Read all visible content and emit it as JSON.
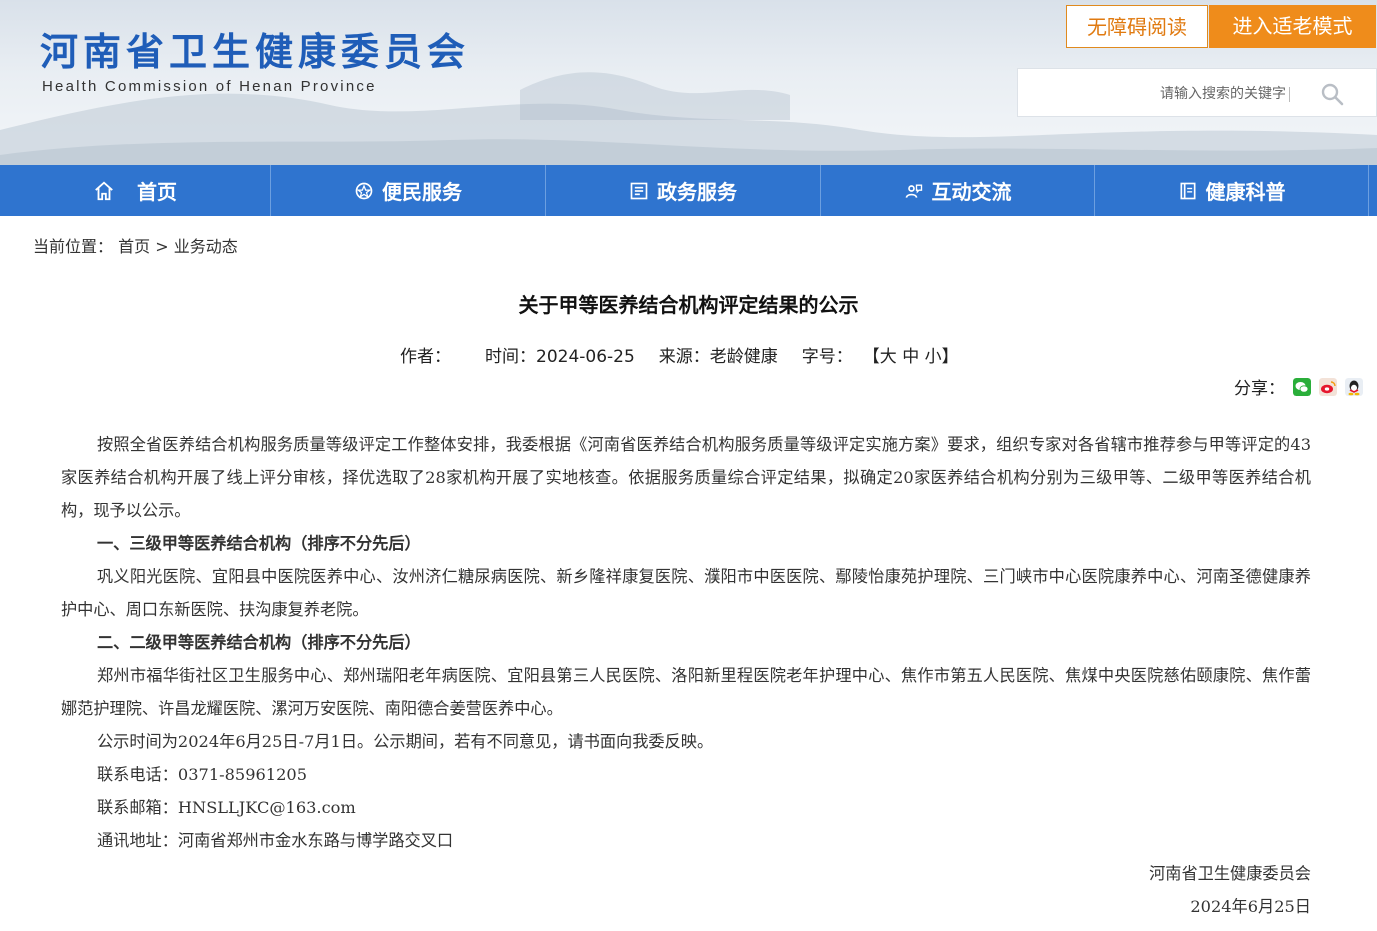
{
  "header": {
    "logo_cn": "河南省卫生健康委员会",
    "logo_en": "Health Commission of Henan Province",
    "accessibility_label": "无障碍阅读",
    "elder_mode_label": "进入适老模式",
    "search_placeholder": "请输入搜索的关键字",
    "brand_color": "#1f5db8",
    "accent_color": "#ef8c1b"
  },
  "nav": {
    "color": "#2f74cf",
    "items": [
      {
        "label": "首页",
        "icon": "home-icon"
      },
      {
        "label": "便民服务",
        "icon": "service-icon"
      },
      {
        "label": "政务服务",
        "icon": "government-icon"
      },
      {
        "label": "互动交流",
        "icon": "interaction-icon"
      },
      {
        "label": "健康科普",
        "icon": "health-book-icon"
      }
    ]
  },
  "breadcrumb": {
    "prefix": "当前位置：",
    "home": "首页",
    "separator": ">",
    "current": "业务动态"
  },
  "article": {
    "title": "关于甲等医养结合机构评定结果的公示",
    "author_label": "作者：",
    "time_label": "时间：",
    "time": "2024-06-25",
    "source_label": "来源：",
    "source": "老龄健康",
    "fontsize_label": "字号：",
    "fontsize_open": "【",
    "fontsize_large": "大",
    "fontsize_medium": "中",
    "fontsize_small": "小",
    "fontsize_close": "】",
    "share_label": "分享：",
    "share_icons": [
      "wechat-icon",
      "weibo-icon",
      "qq-icon"
    ],
    "paragraphs": [
      {
        "text": "按照全省医养结合机构服务质量等级评定工作整体安排，我委根据《河南省医养结合机构服务质量等级评定实施方案》要求，组织专家对各省辖市推荐参与甲等评定的43家医养结合机构开展了线上评分审核，择优选取了28家机构开展了实地核查。依据服务质量综合评定结果，拟确定20家医养结合机构分别为三级甲等、二级甲等医养结合机构，现予以公示。",
        "style": "normal"
      },
      {
        "text": "一、三级甲等医养结合机构（排序不分先后）",
        "style": "h"
      },
      {
        "text": "巩义阳光医院、宜阳县中医院医养中心、汝州济仁糖尿病医院、新乡隆祥康复医院、濮阳市中医医院、鄢陵怡康苑护理院、三门峡市中心医院康养中心、河南圣德健康养护中心、周口东新医院、扶沟康复养老院。",
        "style": "normal"
      },
      {
        "text": "二、二级甲等医养结合机构（排序不分先后）",
        "style": "h"
      },
      {
        "text": "郑州市福华街社区卫生服务中心、郑州瑞阳老年病医院、宜阳县第三人民医院、洛阳新里程医院老年护理中心、焦作市第五人民医院、焦煤中央医院慈佑颐康院、焦作蕾娜范护理院、许昌龙耀医院、漯河万安医院、南阳德合姜营医养中心。",
        "style": "normal"
      },
      {
        "text": "公示时间为2024年6月25日-7月1日。公示期间，若有不同意见，请书面向我委反映。",
        "style": "normal"
      },
      {
        "text": "联系电话：0371-85961205",
        "style": "normal"
      },
      {
        "text": "联系邮箱：HNSLLJKC@163.com",
        "style": "normal"
      },
      {
        "text": "通讯地址：河南省郑州市金水东路与博学路交叉口",
        "style": "normal"
      },
      {
        "text": "河南省卫生健康委员会",
        "style": "right"
      },
      {
        "text": "2024年6月25日",
        "style": "right"
      }
    ]
  }
}
